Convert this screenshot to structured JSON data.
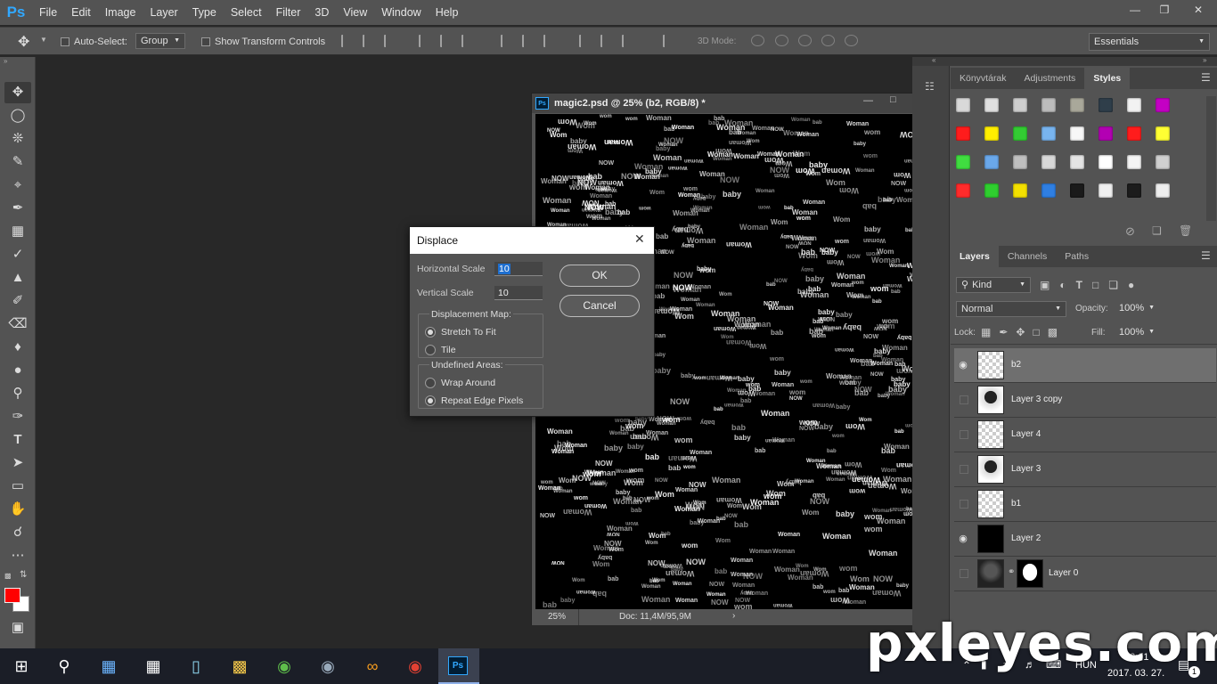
{
  "app": {
    "logo": "Ps",
    "workspace": "Essentials"
  },
  "menu": [
    "File",
    "Edit",
    "Image",
    "Layer",
    "Type",
    "Select",
    "Filter",
    "3D",
    "View",
    "Window",
    "Help"
  ],
  "options": {
    "auto_select": "Auto-Select:",
    "group": "Group",
    "show_transform": "Show Transform Controls",
    "mode_3d": "3D Mode:"
  },
  "document": {
    "title": "magic2.psd @ 25% (b2, RGB/8) *",
    "zoom": "25%",
    "doc_info": "Doc: 11,4M/95,9M",
    "pattern_words": [
      "Woman",
      "Woman",
      "wom",
      "baby",
      "Woman",
      "NOW",
      "Wom",
      "bab"
    ]
  },
  "top_panel": {
    "tabs": [
      "Könyvtárak",
      "Adjustments",
      "Styles"
    ],
    "active": "Styles",
    "swatches": [
      "#d9d9d9",
      "#e0e0e0",
      "#cfcfcf",
      "#bdbdbd",
      "#a9a89a",
      "#2f3e4a",
      "#f2f2f2",
      "#c400c4",
      "#ff1c1c",
      "#ffee00",
      "#33cc33",
      "#78b4ef",
      "#f7f7f7",
      "#b300b3",
      "#ff1c1c",
      "#ffff33",
      "#40dd40",
      "#6aa8ea",
      "#bfbfbf",
      "#d8d8d8",
      "#e4e4e4",
      "#ffffff",
      "#f4f4f4",
      "#d0d0d0",
      "#ff2b2b",
      "#2fce2f",
      "#f3e000",
      "#2f7fe2",
      "#1a1a1a",
      "#f0f0f0",
      "#1c1c1c",
      "#eeeeee"
    ]
  },
  "layers_panel": {
    "tabs": [
      "Layers",
      "Channels",
      "Paths"
    ],
    "active": "Layers",
    "kind": "Kind",
    "blend": "Normal",
    "opacity_label": "Opacity:",
    "opacity": "100%",
    "lock_label": "Lock:",
    "fill_label": "Fill:",
    "fill": "100%",
    "layers": [
      {
        "name": "b2",
        "visible": true,
        "selected": true,
        "thumb": "checker"
      },
      {
        "name": "Layer 3 copy",
        "visible": false,
        "selected": false,
        "thumb": "face"
      },
      {
        "name": "Layer 4",
        "visible": false,
        "selected": false,
        "thumb": "checker"
      },
      {
        "name": "Layer 3",
        "visible": false,
        "selected": false,
        "thumb": "face"
      },
      {
        "name": "b1",
        "visible": false,
        "selected": false,
        "thumb": "checker"
      },
      {
        "name": "Layer 2",
        "visible": true,
        "selected": false,
        "thumb": "black"
      },
      {
        "name": "Layer 0",
        "visible": false,
        "selected": false,
        "thumb": "masked"
      }
    ]
  },
  "dialog": {
    "title": "Displace",
    "h_label": "Horizontal Scale",
    "h_value": "10",
    "v_label": "Vertical Scale",
    "v_value": "10",
    "map_legend": "Displacement Map:",
    "map_opts": [
      "Stretch To Fit",
      "Tile"
    ],
    "map_selected": 0,
    "undef_legend": "Undefined Areas:",
    "undef_opts": [
      "Wrap Around",
      "Repeat Edge Pixels"
    ],
    "undef_selected": 1,
    "ok": "OK",
    "cancel": "Cancel"
  },
  "taskbar": {
    "lang": "HUN",
    "time": "13:01",
    "date": "2017. 03. 27.",
    "notif": "1"
  },
  "watermark": "pxleyes.com"
}
